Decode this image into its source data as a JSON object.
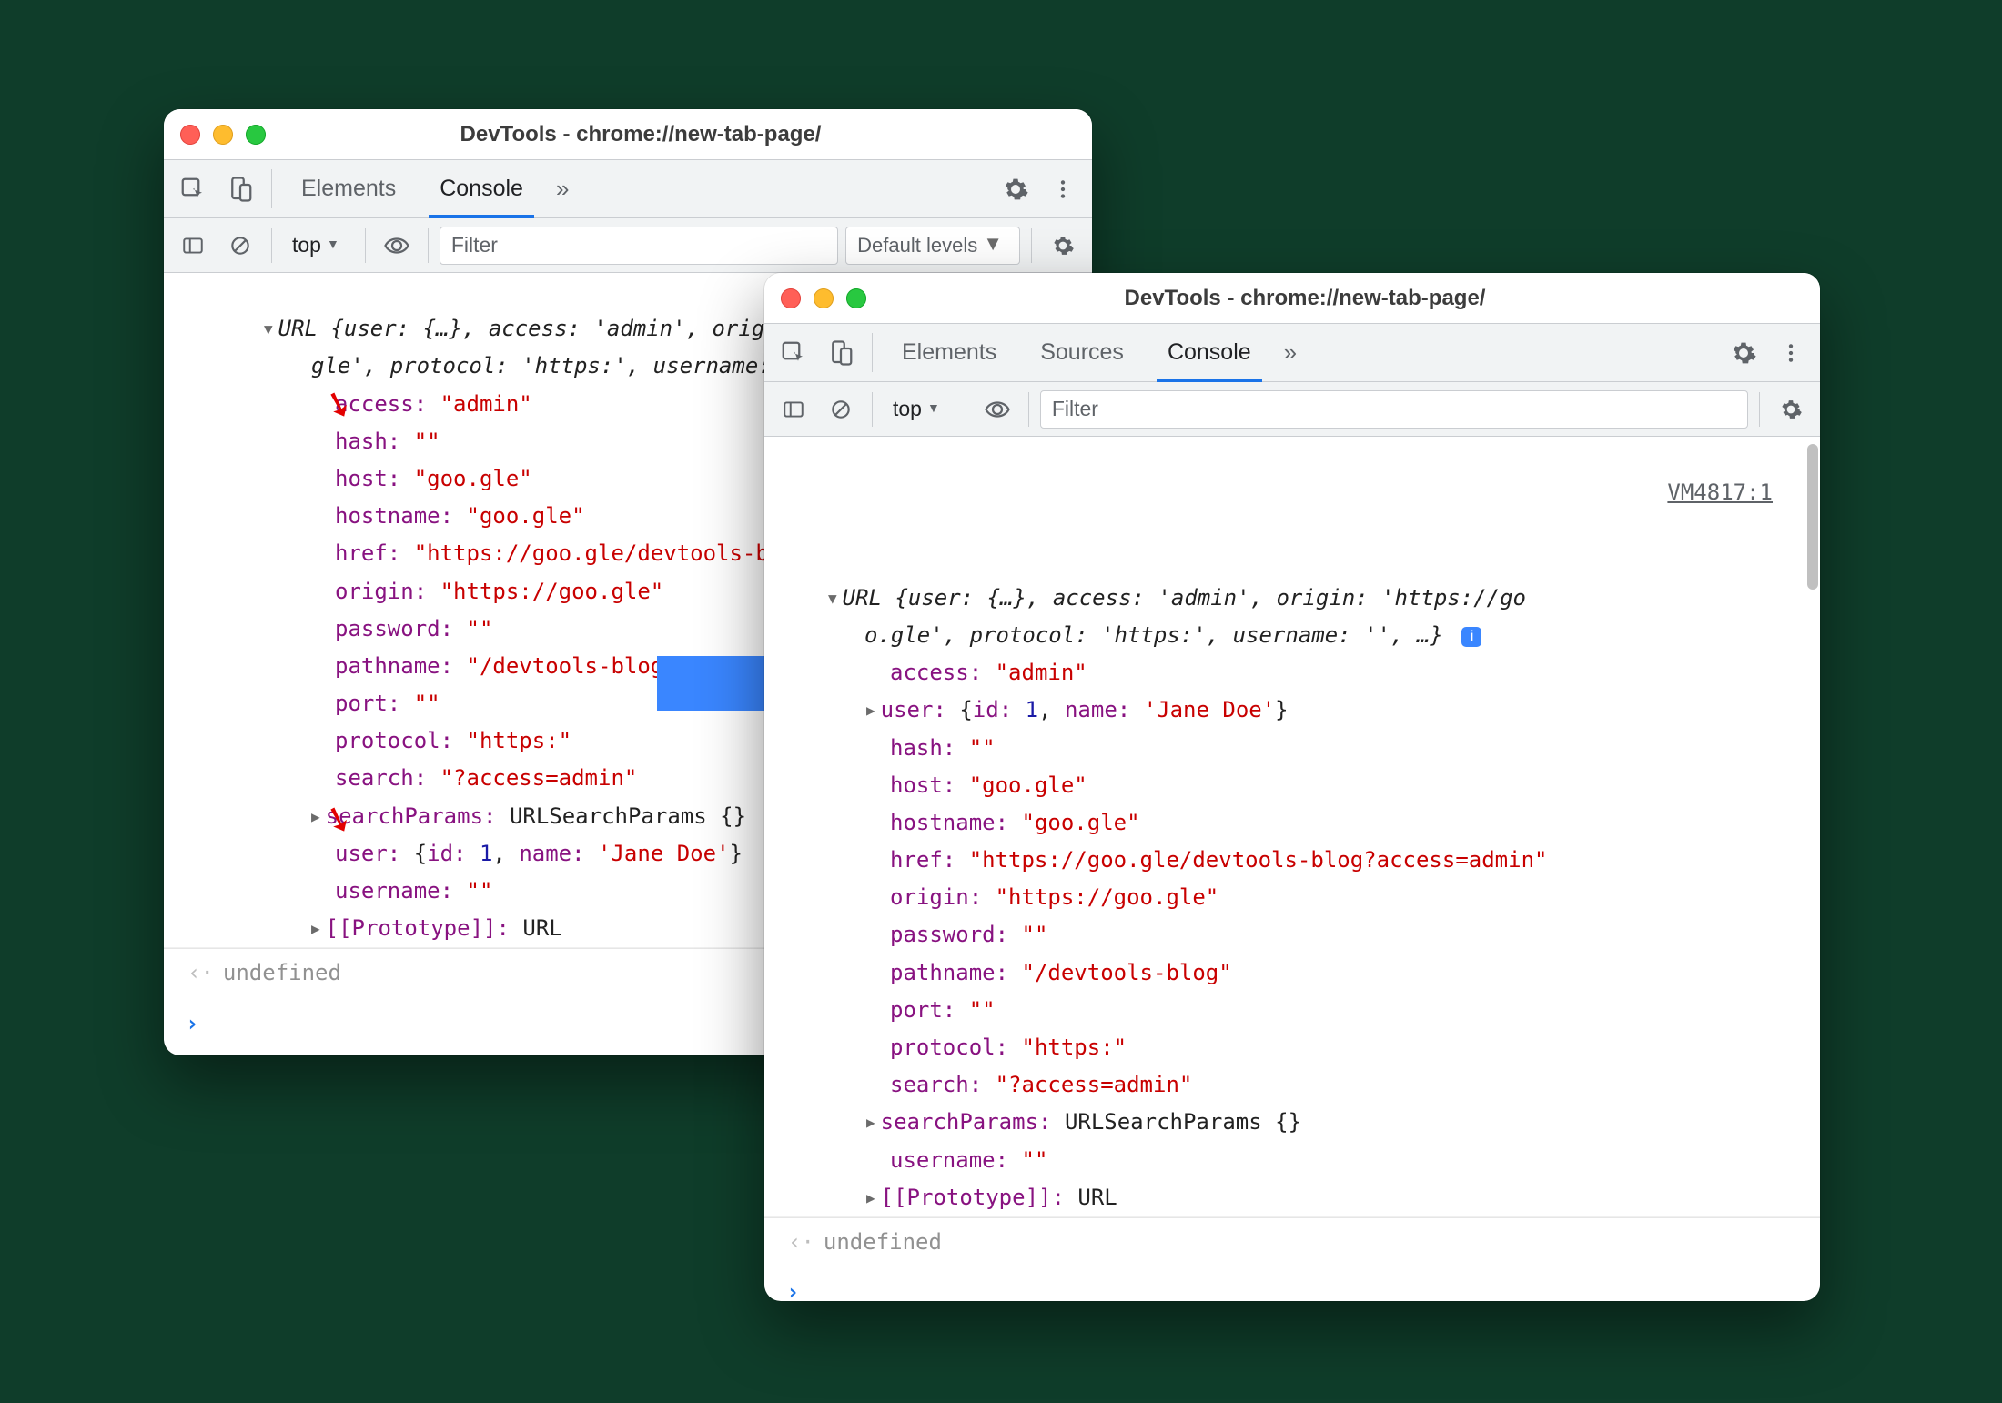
{
  "left": {
    "title": "DevTools - chrome://new-tab-page/",
    "tabs": {
      "elements": "Elements",
      "console": "Console"
    },
    "toolbar": {
      "context": "top",
      "filter_placeholder": "Filter",
      "levels": "Default levels"
    },
    "summary_line1": "URL {user: {…}, access: 'admin', orig",
    "summary_line2": "gle', protocol: 'https:', username: '",
    "props": {
      "access_k": "access:",
      "access_v": "\"admin\"",
      "hash_k": "hash:",
      "hash_v": "\"\"",
      "host_k": "host:",
      "host_v": "\"goo.gle\"",
      "hostname_k": "hostname:",
      "hostname_v": "\"goo.gle\"",
      "href_k": "href:",
      "href_v": "\"https://goo.gle/devtools-blog",
      "origin_k": "origin:",
      "origin_v": "\"https://goo.gle\"",
      "password_k": "password:",
      "password_v": "\"\"",
      "pathname_k": "pathname:",
      "pathname_v": "\"/devtools-blog\"",
      "port_k": "port:",
      "port_v": "\"\"",
      "protocol_k": "protocol:",
      "protocol_v": "\"https:\"",
      "search_k": "search:",
      "search_v": "\"?access=admin\"",
      "searchParams_k": "searchParams:",
      "searchParams_v": "URLSearchParams {}",
      "user_k": "user:",
      "user_open": "{",
      "user_id_k": "id:",
      "user_id_v": "1",
      "user_sep": ", ",
      "user_name_k": "name:",
      "user_name_v": "'Jane Doe'",
      "user_close": "}",
      "username_k": "username:",
      "username_v": "\"\"",
      "proto_k": "[[Prototype]]:",
      "proto_v": "URL"
    },
    "undefined": "undefined"
  },
  "right": {
    "title": "DevTools - chrome://new-tab-page/",
    "tabs": {
      "elements": "Elements",
      "sources": "Sources",
      "console": "Console"
    },
    "toolbar": {
      "context": "top",
      "filter_placeholder": "Filter"
    },
    "src_link": "VM4817:1",
    "summary_line1": "URL {user: {…}, access: 'admin', origin: 'https://go",
    "summary_line2": "o.gle', protocol: 'https:', username: '', …}",
    "props": {
      "access_k": "access:",
      "access_v": "\"admin\"",
      "user_k": "user:",
      "user_open": "{",
      "user_id_k": "id:",
      "user_id_v": "1",
      "user_sep": ", ",
      "user_name_k": "name:",
      "user_name_v": "'Jane Doe'",
      "user_close": "}",
      "hash_k": "hash:",
      "hash_v": "\"\"",
      "host_k": "host:",
      "host_v": "\"goo.gle\"",
      "hostname_k": "hostname:",
      "hostname_v": "\"goo.gle\"",
      "href_k": "href:",
      "href_v": "\"https://goo.gle/devtools-blog?access=admin\"",
      "origin_k": "origin:",
      "origin_v": "\"https://goo.gle\"",
      "password_k": "password:",
      "password_v": "\"\"",
      "pathname_k": "pathname:",
      "pathname_v": "\"/devtools-blog\"",
      "port_k": "port:",
      "port_v": "\"\"",
      "protocol_k": "protocol:",
      "protocol_v": "\"https:\"",
      "search_k": "search:",
      "search_v": "\"?access=admin\"",
      "searchParams_k": "searchParams:",
      "searchParams_v": "URLSearchParams {}",
      "username_k": "username:",
      "username_v": "\"\"",
      "proto_k": "[[Prototype]]:",
      "proto_v": "URL"
    },
    "undefined": "undefined"
  }
}
